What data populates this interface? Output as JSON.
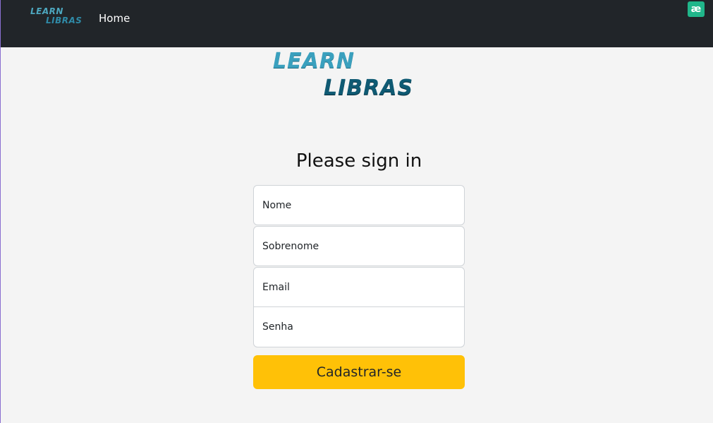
{
  "navbar": {
    "logo": {
      "line1": "LEARN",
      "line2": "LIBRAS"
    },
    "home_label": "Home",
    "extension_icon_glyph": "æ",
    "background": "#212529"
  },
  "hero": {
    "logo": {
      "line1": "LEARN",
      "line2": "LIBRAS"
    }
  },
  "form": {
    "title": "Please sign in",
    "fields": {
      "nome_placeholder": "Nome",
      "sobrenome_placeholder": "Sobrenome",
      "email_placeholder": "Email",
      "senha_placeholder": "Senha"
    },
    "submit_label": "Cadastrar-se",
    "accent_color": "#ffc107"
  },
  "icons": {
    "extension": "extension-icon"
  }
}
